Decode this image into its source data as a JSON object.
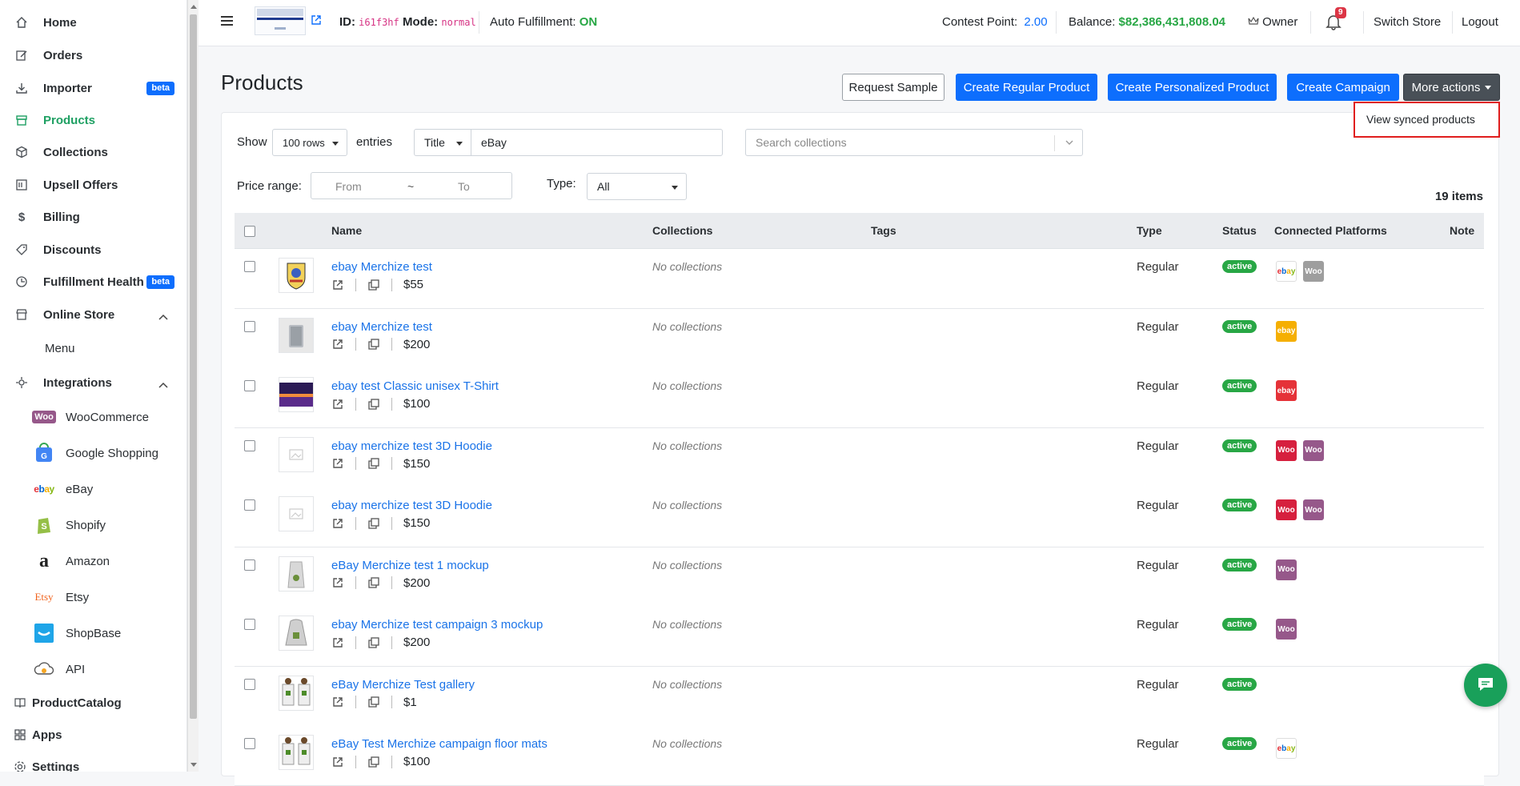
{
  "sidebar": {
    "items": [
      {
        "label": "Home"
      },
      {
        "label": "Orders"
      },
      {
        "label": "Importer",
        "badge": "beta"
      },
      {
        "label": "Products"
      },
      {
        "label": "Collections"
      },
      {
        "label": "Upsell Offers"
      },
      {
        "label": "Billing"
      },
      {
        "label": "Discounts"
      },
      {
        "label": "Fulfillment Health",
        "badge": "beta"
      },
      {
        "label": "Online Store"
      },
      {
        "label": "Integrations"
      },
      {
        "label": "ProductCatalog"
      },
      {
        "label": "Apps"
      },
      {
        "label": "Settings"
      }
    ],
    "online_store_sub": "Menu",
    "integrations": [
      "WooCommerce",
      "Google Shopping",
      "eBay",
      "Shopify",
      "Amazon",
      "Etsy",
      "ShopBase",
      "API"
    ],
    "active_color": "#1fa063"
  },
  "topbar": {
    "id_label": "ID:",
    "id_value": "i61f3hf",
    "mode_label": "Mode:",
    "mode_value": "normal",
    "auto_label": "Auto Fulfillment:",
    "auto_value": "ON",
    "contest_label": "Contest Point:",
    "contest_value": "2.00",
    "balance_label": "Balance:",
    "balance_value": "$82,386,431,808.04",
    "owner": "Owner",
    "notifications": "9",
    "switch_store": "Switch Store",
    "logout": "Logout"
  },
  "page": {
    "title": "Products",
    "buttons": {
      "request_sample": "Request Sample",
      "create_regular": "Create Regular Product",
      "create_personalized": "Create Personalized Product",
      "create_campaign": "Create Campaign",
      "more_actions": "More actions"
    },
    "dropdown": {
      "view_synced": "View synced products"
    }
  },
  "filters": {
    "show_label": "Show",
    "rows_value": "100 rows",
    "entries_label": "entries",
    "field_select": "Title",
    "search_value": "eBay",
    "collections_placeholder": "Search collections",
    "price_label": "Price range:",
    "from_placeholder": "From",
    "tilde": "~",
    "to_placeholder": "To",
    "type_label": "Type:",
    "type_value": "All",
    "items_count": "19 items"
  },
  "table": {
    "headers": [
      "Name",
      "Collections",
      "Tags",
      "Type",
      "Status",
      "Connected Platforms",
      "Note"
    ],
    "rows": [
      {
        "name": "ebay Merchize test",
        "price": "$55",
        "collections": "No collections",
        "type": "Regular",
        "status": "active",
        "platforms": [
          {
            "kind": "ebay",
            "label": "ebay"
          },
          {
            "kind": "woo-grey",
            "label": "Woo"
          }
        ]
      },
      {
        "name": "ebay Merchize test",
        "price": "$200",
        "collections": "No collections",
        "type": "Regular",
        "status": "active",
        "platforms": [
          {
            "kind": "ebay-yellow",
            "label": "ebay"
          }
        ]
      },
      {
        "name": "ebay test Classic unisex T-Shirt",
        "price": "$100",
        "collections": "No collections",
        "type": "Regular",
        "status": "active",
        "platforms": [
          {
            "kind": "ebay-red",
            "label": "ebay"
          }
        ]
      },
      {
        "name": "ebay merchize test 3D Hoodie",
        "price": "$150",
        "collections": "No collections",
        "type": "Regular",
        "status": "active",
        "platforms": [
          {
            "kind": "woo-red",
            "label": "Woo"
          },
          {
            "kind": "woo-purple",
            "label": "Woo"
          }
        ]
      },
      {
        "name": "ebay merchize test 3D Hoodie",
        "price": "$150",
        "collections": "No collections",
        "type": "Regular",
        "status": "active",
        "platforms": [
          {
            "kind": "woo-red",
            "label": "Woo"
          },
          {
            "kind": "woo-purple",
            "label": "Woo"
          }
        ]
      },
      {
        "name": "eBay Merchize test 1 mockup",
        "price": "$200",
        "collections": "No collections",
        "type": "Regular",
        "status": "active",
        "platforms": [
          {
            "kind": "woo-purple",
            "label": "Woo"
          }
        ]
      },
      {
        "name": "ebay Merchize test campaign 3 mockup",
        "price": "$200",
        "collections": "No collections",
        "type": "Regular",
        "status": "active",
        "platforms": [
          {
            "kind": "woo-purple",
            "label": "Woo"
          }
        ]
      },
      {
        "name": "eBay Merchize Test gallery",
        "price": "$1",
        "collections": "No collections",
        "type": "Regular",
        "status": "active",
        "platforms": []
      },
      {
        "name": "eBay Test Merchize campaign floor mats",
        "price": "$100",
        "collections": "No collections",
        "type": "Regular",
        "status": "active",
        "platforms": [
          {
            "kind": "ebay",
            "label": "ebay"
          }
        ]
      }
    ]
  },
  "icons": [
    "home-icon",
    "orders-icon",
    "importer-icon",
    "products-icon",
    "collections-icon",
    "upsell-icon",
    "billing-icon",
    "discounts-icon",
    "health-icon",
    "store-icon",
    "integrations-icon",
    "catalog-icon",
    "apps-icon",
    "settings-icon",
    "bell-icon",
    "crown-icon",
    "external-link-icon",
    "copy-icon",
    "chat-icon"
  ]
}
